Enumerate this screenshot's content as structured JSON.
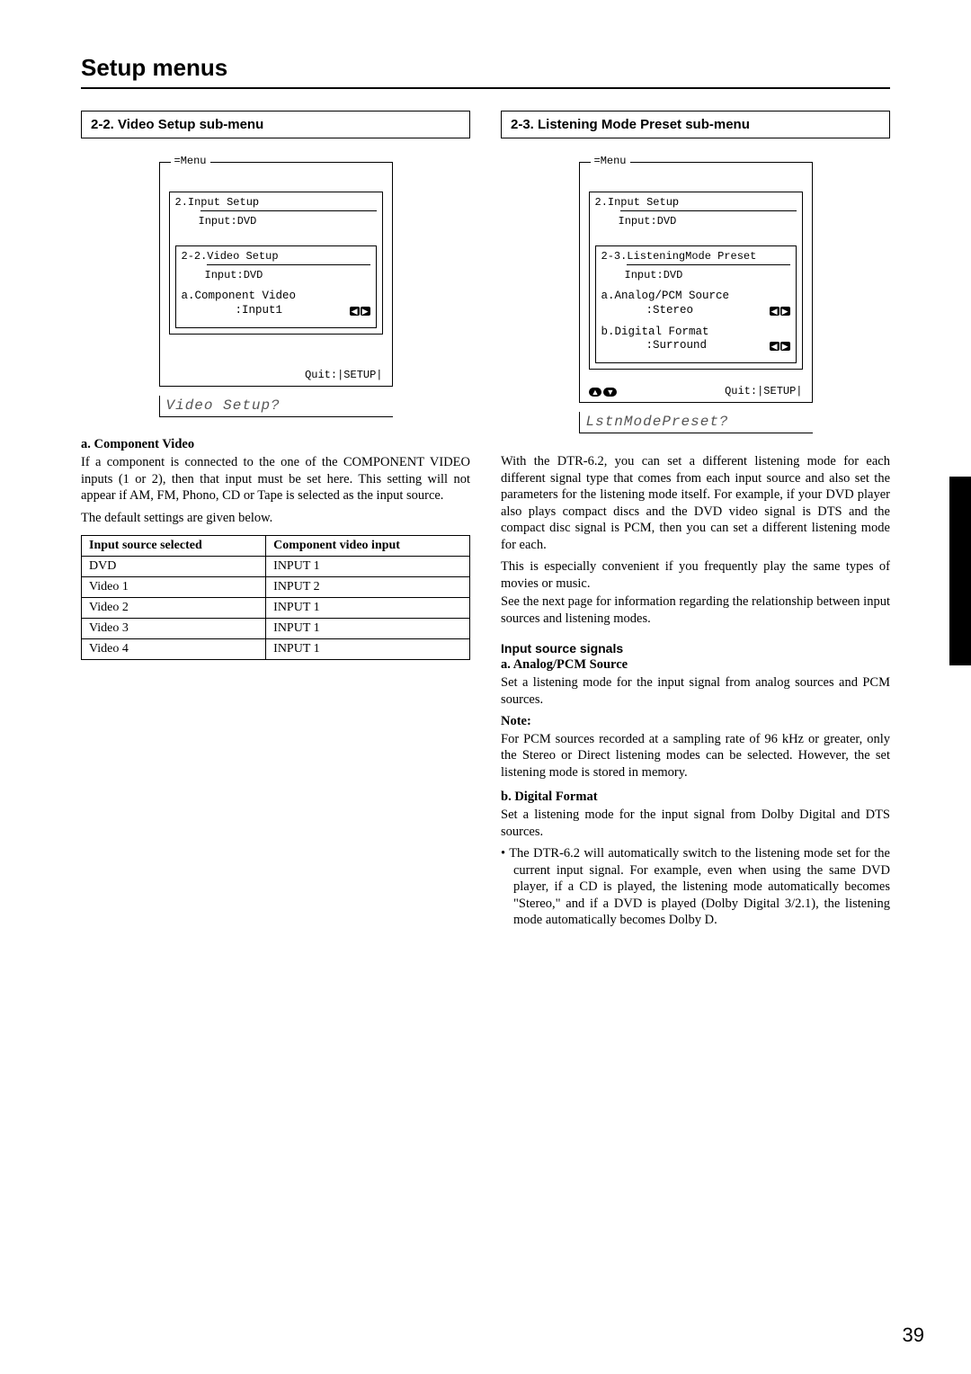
{
  "page_title": "Setup menus",
  "page_number": "39",
  "left": {
    "header": "2-2.  Video Setup sub-menu",
    "osd": {
      "menu_label": "=Menu",
      "l1_title": "2.Input Setup",
      "l1_input": "Input:DVD",
      "l2_title": "2-2.Video Setup",
      "l2_input": "Input:DVD",
      "item_a": "a.Component Video",
      "item_a_value": ":Input1",
      "quit": "Quit:|SETUP|"
    },
    "seg": "Video Setup?",
    "section_a_title": "a. Component Video",
    "section_a_text": "If a component is connected to the one of the COMPONENT VIDEO inputs (1 or 2), then that input must be set here. This setting will not appear if AM, FM, Phono, CD or Tape is selected as the input source.",
    "defaults_intro": "The default settings are given below.",
    "table": {
      "h1": "Input source selected",
      "h2": "Component video input",
      "rows": [
        {
          "src": "DVD",
          "inp": "INPUT 1"
        },
        {
          "src": "Video 1",
          "inp": "INPUT 2"
        },
        {
          "src": "Video 2",
          "inp": "INPUT 1"
        },
        {
          "src": "Video 3",
          "inp": "INPUT 1"
        },
        {
          "src": "Video 4",
          "inp": "INPUT 1"
        }
      ]
    }
  },
  "right": {
    "header": "2-3.  Listening Mode Preset sub-menu",
    "osd": {
      "menu_label": "=Menu",
      "l1_title": "2.Input Setup",
      "l1_input": "Input:DVD",
      "l2_title": "2-3.ListeningMode Preset",
      "l2_input": "Input:DVD",
      "item_a": "a.Analog/PCM Source",
      "item_a_value": ":Stereo",
      "item_b": "b.Digital Format",
      "item_b_value": ":Surround",
      "quit": "Quit:|SETUP|"
    },
    "seg": "LstnModePreset?",
    "intro1": "With the DTR-6.2, you can set a different listening mode for each different signal type that comes from each input source and also set the parameters for the listening mode itself. For example, if your DVD player also plays compact discs and the DVD video signal is DTS and the compact disc signal is PCM, then you can set a different listening mode for each.",
    "intro2": "This is especially convenient if you frequently play the same types of movies or music.",
    "intro3": "See the next page for information regarding the relationship between input sources and listening modes.",
    "signals_heading": "Input source signals",
    "a_title": "a.   Analog/PCM Source",
    "a_text": "Set a listening mode for the input signal from analog sources and PCM sources.",
    "note_label": "Note:",
    "note_text": "For PCM sources recorded at a sampling rate of 96 kHz or greater, only the Stereo or Direct listening modes can be selected. However, the set listening mode is stored in memory.",
    "b_title": "b.   Digital Format",
    "b_text": "Set a listening mode for the input signal from Dolby Digital and DTS sources.",
    "bullet": "The DTR-6.2 will automatically switch to the listening mode set for the current input signal. For example, even when using the same DVD player, if a CD is played, the listening mode automatically becomes \"Stereo,\" and if a DVD is played (Dolby Digital 3/2.1), the listening mode automatically becomes Dolby D."
  }
}
